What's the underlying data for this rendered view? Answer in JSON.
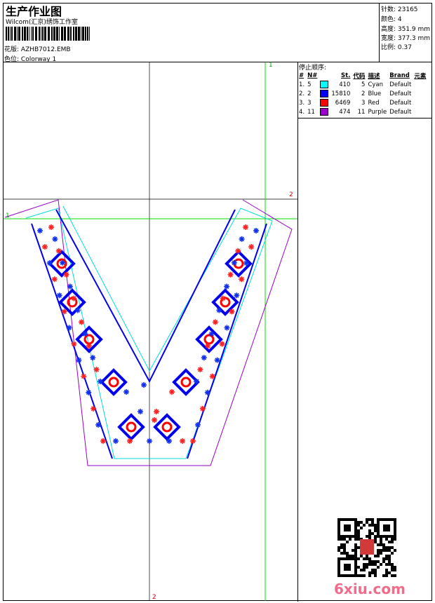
{
  "header": {
    "title": "生产作业图",
    "company": "Wilcom(汇京)绣饰工作室",
    "design_label": "花版:",
    "design_value": "AZHB7012.EMB",
    "colorway_label": "色位:",
    "colorway_value": "Colorway 1"
  },
  "info": {
    "stitches": "针数: 23165",
    "colors": "颜色: 4",
    "height": "高度: 351.9 mm",
    "width": "宽度: 377.3 mm",
    "scale": "比例: 0.37"
  },
  "stop_sequence": {
    "title": "停止顺序:",
    "columns": [
      "#",
      "N#",
      "St.",
      "代码",
      "描述",
      "Brand",
      "元素"
    ],
    "rows": [
      {
        "n": "1.",
        "num": "5",
        "color": "#00ffff",
        "st": "410",
        "code": "5",
        "desc": "Cyan",
        "brand": "Default"
      },
      {
        "n": "2.",
        "num": "2",
        "color": "#0000ff",
        "st": "15810",
        "code": "2",
        "desc": "Blue",
        "brand": "Default"
      },
      {
        "n": "3.",
        "num": "3",
        "color": "#ff0000",
        "st": "6469",
        "code": "3",
        "desc": "Red",
        "brand": "Default"
      },
      {
        "n": "4.",
        "num": "11",
        "color": "#9900cc",
        "st": "474",
        "code": "11",
        "desc": "Purple",
        "brand": "Default"
      }
    ]
  },
  "guides": {
    "green_v": "1",
    "green_h": "1",
    "red_h": "2",
    "red_v": "2"
  },
  "watermark": "6xiu.com"
}
